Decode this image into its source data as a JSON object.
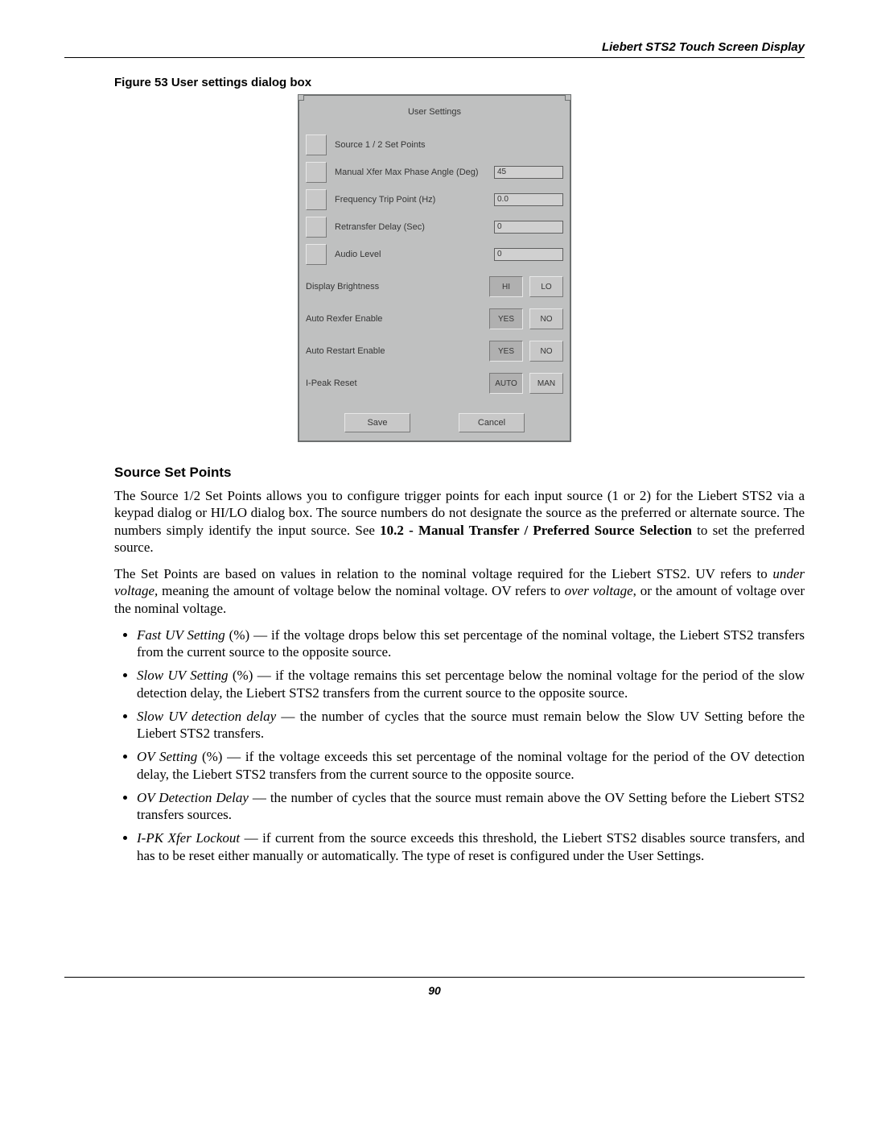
{
  "header": {
    "title": "Liebert STS2 Touch Screen Display"
  },
  "figure": {
    "caption": "Figure 53  User settings dialog box"
  },
  "dialog": {
    "title": "User Settings",
    "rows": [
      {
        "label": "Source 1 / 2 Set Points",
        "value": ""
      },
      {
        "label": "Manual Xfer Max Phase Angle (Deg)",
        "value": "45"
      },
      {
        "label": "Frequency Trip Point (Hz)",
        "value": "0.0"
      },
      {
        "label": "Retransfer Delay (Sec)",
        "value": "0"
      },
      {
        "label": "Audio Level",
        "value": "0"
      }
    ],
    "toggles": [
      {
        "label": "Display Brightness",
        "a": "HI",
        "b": "LO",
        "sel": "a"
      },
      {
        "label": "Auto Rexfer Enable",
        "a": "YES",
        "b": "NO",
        "sel": "a"
      },
      {
        "label": "Auto Restart Enable",
        "a": "YES",
        "b": "NO",
        "sel": "a"
      },
      {
        "label": "I-Peak Reset",
        "a": "AUTO",
        "b": "MAN",
        "sel": "a"
      }
    ],
    "save": "Save",
    "cancel": "Cancel"
  },
  "section": {
    "title": "Source Set Points"
  },
  "para1": "The Source 1/2 Set Points allows you to configure trigger points for each input source (1 or 2) for the Liebert STS2 via a keypad dialog or HI/LO dialog box. The source numbers do not designate the source as the preferred or alternate source. The numbers simply identify the input source. See <b>10.2 - Manual Transfer / Preferred Source Selection</b> to set the preferred source.",
  "para2": "The Set Points are based on values in relation to the nominal voltage required for the Liebert STS2. UV refers to <i>under voltage,</i> meaning the amount of voltage below the nominal voltage. OV refers to <i>over voltage</i>, or the amount of voltage over the nominal voltage.",
  "bullets": [
    "<i>Fast UV Setting</i> (%) — if the voltage drops below this set percentage of the nominal voltage, the Liebert STS2 transfers from the current source to the opposite source.",
    "<i>Slow UV Setting</i> (%) — if the voltage remains this set percentage below the nominal voltage for the period of the slow detection delay, the Liebert STS2 transfers from the current source to the opposite source.",
    "<i>Slow UV detection delay</i> — the number of cycles that the source must remain below the Slow UV Setting before the Liebert STS2 transfers.",
    "<i>OV Setting</i> (%) — if the voltage exceeds this set percentage of the nominal voltage for the period of the OV detection delay, the Liebert STS2 transfers from the current source to the opposite source.",
    "<i>OV Detection Delay</i> — the number of cycles that the source must remain above the OV Setting before the Liebert STS2 transfers sources.",
    "<i>I-PK Xfer Lockout</i> — if current from the source exceeds this threshold, the Liebert STS2 disables source transfers, and has to be reset either manually or automatically. The type of reset is configured under the User Settings."
  ],
  "page_number": "90"
}
